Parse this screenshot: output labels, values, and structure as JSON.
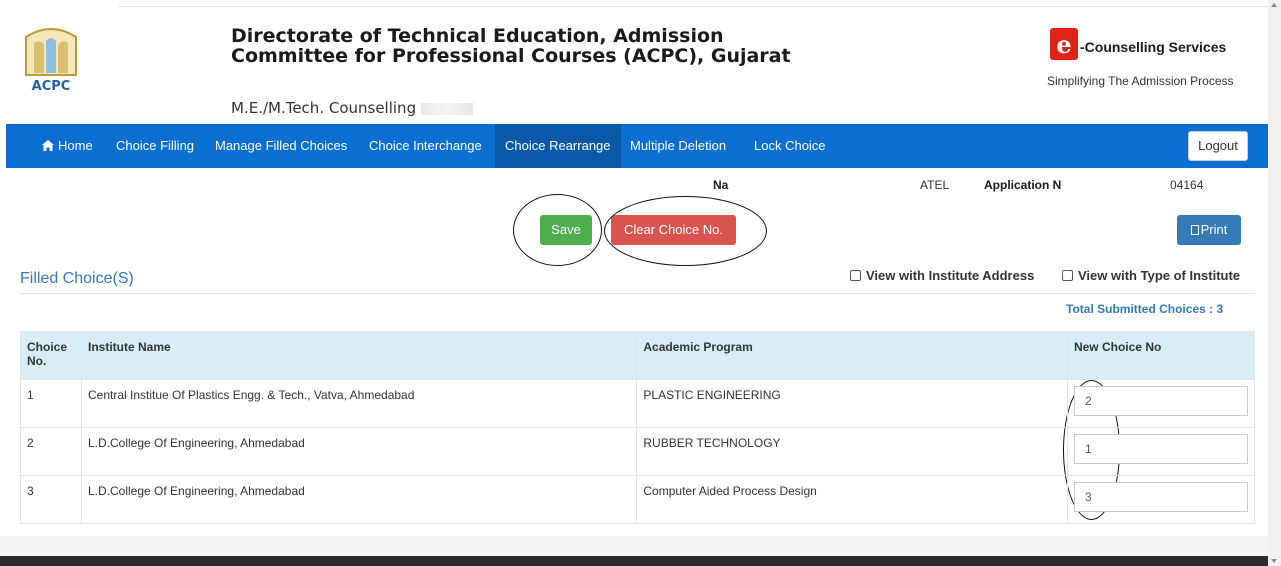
{
  "header": {
    "title": "Directorate of Technical Education, Admission Committee for Professional Courses (ACPC), Gujarat",
    "subtitle": "M.E./M.Tech. Counselling",
    "logo_text": "ACPC",
    "brand_name": "-Counselling Services",
    "brand_tagline": "Simplifying The Admission Process"
  },
  "nav": {
    "items": [
      {
        "label": "Home",
        "icon": "home-icon"
      },
      {
        "label": "Choice Filling"
      },
      {
        "label": "Manage Filled Choices"
      },
      {
        "label": "Choice Interchange"
      },
      {
        "label": "Choice Rearrange",
        "active": true
      },
      {
        "label": "Multiple Deletion"
      },
      {
        "label": "Lock Choice"
      }
    ],
    "logout_label": "Logout"
  },
  "info": {
    "name_label": "Na",
    "name_value": "ATEL",
    "app_label": "Application N",
    "app_value": "04164"
  },
  "actions": {
    "save_label": "Save",
    "clear_label": "Clear Choice No.",
    "print_label": "Print"
  },
  "section": {
    "title": "Filled Choice(S)",
    "opt_address": "View with Institute Address",
    "opt_type": "View with Type of Institute",
    "total": "Total Submitted Choices : 3"
  },
  "table": {
    "headers": [
      "Choice No.",
      "Institute Name",
      "Academic Program",
      "New Choice No"
    ],
    "rows": [
      {
        "no": "1",
        "institute": "Central Institue Of Plastics Engg. & Tech., Vatva, Ahmedabad",
        "program": "PLASTIC ENGINEERING",
        "new_no": "2"
      },
      {
        "no": "2",
        "institute": "L.D.College Of Engineering, Ahmedabad",
        "program": "RUBBER TECHNOLOGY",
        "new_no": "1"
      },
      {
        "no": "3",
        "institute": "L.D.College Of Engineering, Ahmedabad",
        "program": "Computer Aided Process Design",
        "new_no": "3"
      }
    ]
  },
  "colors": {
    "nav_bg": "#0b6fd1",
    "nav_active": "#0a59a8",
    "save": "#4cae4c",
    "clear": "#d9534f",
    "print": "#337ab7",
    "link": "#337ab7",
    "table_header": "#d9edf7"
  }
}
